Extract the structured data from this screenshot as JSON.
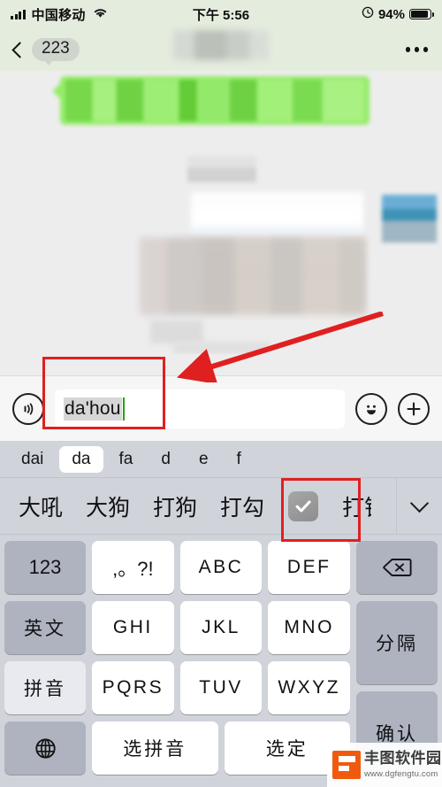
{
  "status_bar": {
    "carrier": "中国移动",
    "time": "下午 5:56",
    "battery_percent": "94%",
    "signal_icon": "signal-bars-icon",
    "wifi_icon": "wifi-icon",
    "alarm_icon": "alarm-icon",
    "battery_icon": "battery-icon"
  },
  "nav_bar": {
    "back_icon": "back-chevron-icon",
    "back_badge": "223",
    "title": "",
    "more_icon": "more-options-icon"
  },
  "input_bar": {
    "voice_icon": "voice-input-icon",
    "text_typed": "da'hou",
    "text_highlight": "da",
    "text_rest": "'hou",
    "emoji_icon": "emoji-smiley-icon",
    "plus_icon": "plus-circle-icon"
  },
  "keyboard": {
    "pinyin_segments": [
      {
        "label": "dai",
        "selected": false
      },
      {
        "label": "da",
        "selected": true
      },
      {
        "label": "fa",
        "selected": false
      },
      {
        "label": "d",
        "selected": false
      },
      {
        "label": "e",
        "selected": false
      },
      {
        "label": "f",
        "selected": false
      }
    ],
    "candidates": [
      {
        "label": "大吼",
        "type": "word"
      },
      {
        "label": "大狗",
        "type": "word"
      },
      {
        "label": "打狗",
        "type": "word"
      },
      {
        "label": "打勾",
        "type": "word"
      },
      {
        "label": "☑️",
        "type": "emoji",
        "icon": "checkbox-checked-emoji"
      },
      {
        "label": "打钩",
        "type": "word"
      }
    ],
    "expand_icon": "chevron-down-icon",
    "rows": [
      [
        {
          "label": "123",
          "style": "fn"
        },
        {
          "label": ",。?!",
          "style": "white"
        },
        {
          "label": "ABC",
          "style": "white"
        },
        {
          "label": "DEF",
          "style": "white"
        },
        {
          "label": "",
          "style": "fn",
          "icon": "backspace-icon"
        }
      ],
      [
        {
          "label": "英文",
          "style": "fn"
        },
        {
          "label": "GHI",
          "style": "white"
        },
        {
          "label": "JKL",
          "style": "white"
        },
        {
          "label": "MNO",
          "style": "white"
        },
        {
          "label": "分隔",
          "style": "fn"
        }
      ],
      [
        {
          "label": "拼音",
          "style": "active"
        },
        {
          "label": "PQRS",
          "style": "white"
        },
        {
          "label": "TUV",
          "style": "white"
        },
        {
          "label": "WXYZ",
          "style": "white"
        },
        {
          "label": "确认",
          "style": "fn"
        }
      ],
      [
        {
          "label": "",
          "style": "fn",
          "icon": "globe-icon"
        },
        {
          "label": "选拼音",
          "style": "white"
        },
        {
          "label": "选定",
          "style": "white"
        }
      ]
    ]
  },
  "annotations": {
    "highlight_box_input": "red-box-input-field",
    "highlight_box_candidate": "red-box-checkmark-candidate",
    "arrow": "red-arrow-pointing-to-input"
  },
  "watermark": {
    "name": "丰图软件园",
    "url": "www.dgfengtu.com"
  },
  "colors": {
    "accent_green": "#95ec69",
    "status_bg": "#e4ecde",
    "annotation_red": "#e02020",
    "keyboard_bg": "#d0d3da",
    "key_fn": "#aeb3bf",
    "watermark_orange": "#f15a0e"
  }
}
